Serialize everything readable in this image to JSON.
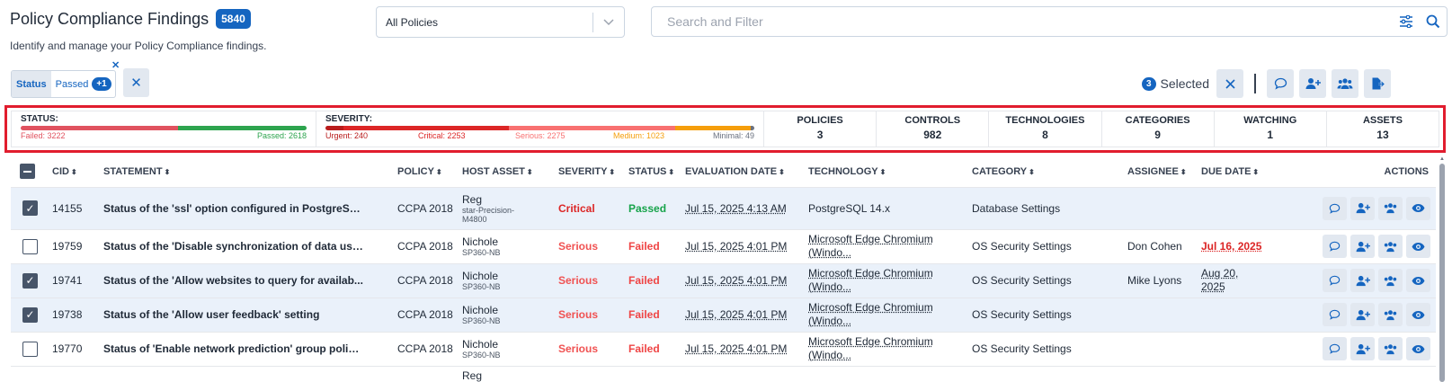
{
  "header": {
    "title": "Policy Compliance Findings",
    "count": "5840",
    "subtitle": "Identify and manage your Policy Compliance findings."
  },
  "policy_select": {
    "value": "All Policies"
  },
  "search": {
    "placeholder": "Search and Filter"
  },
  "filter_chip": {
    "key": "Status",
    "value": "Passed",
    "more": "+1"
  },
  "selection": {
    "count": "3",
    "label": "Selected"
  },
  "summary": {
    "status": {
      "label": "STATUS:",
      "failed_label": "Failed: 3222",
      "passed_label": "Passed: 2618",
      "failed": 3222,
      "passed": 2618,
      "colors": {
        "failed": "#e0525f",
        "passed": "#2da44e"
      }
    },
    "severity": {
      "label": "SEVERITY:",
      "urgent_label": "Urgent: 240",
      "critical_label": "Critical: 2253",
      "serious_label": "Serious: 2275",
      "medium_label": "Medium: 1023",
      "minimal_label": "Minimal: 49",
      "urgent": 240,
      "critical": 2253,
      "serious": 2275,
      "medium": 1023,
      "minimal": 49,
      "colors": {
        "urgent": "#b91c1c",
        "critical": "#dc2626",
        "serious": "#f87171",
        "medium": "#f59e0b",
        "minimal": "#6b7280"
      }
    },
    "metrics": [
      {
        "label": "POLICIES",
        "value": "3"
      },
      {
        "label": "CONTROLS",
        "value": "982"
      },
      {
        "label": "TECHNOLOGIES",
        "value": "8"
      },
      {
        "label": "CATEGORIES",
        "value": "9"
      },
      {
        "label": "WATCHING",
        "value": "1"
      },
      {
        "label": "ASSETS",
        "value": "13"
      }
    ]
  },
  "table": {
    "headers": {
      "cid": "CID",
      "statement": "STATEMENT",
      "policy": "POLICY",
      "host": "HOST ASSET",
      "severity": "SEVERITY",
      "status": "STATUS",
      "eval_date": "EVALUATION DATE",
      "technology": "TECHNOLOGY",
      "category": "CATEGORY",
      "assignee": "ASSIGNEE",
      "due": "DUE DATE",
      "actions": "ACTIONS"
    },
    "rows": [
      {
        "cid": "14155",
        "statement": "Status of the 'ssl' option configured in PostgreSQ...",
        "policy": "CCPA 2018",
        "host": "Reg",
        "host_sub": "star-Precision-M4800",
        "severity": "Critical",
        "status": "Passed",
        "eval_date": "Jul 15, 2025 4:13 AM",
        "technology": "PostgreSQL 14.x",
        "tech2": "",
        "category": "Database Settings",
        "assignee": "",
        "due": ""
      },
      {
        "cid": "19759",
        "statement": "Status of the 'Disable synchronization of data usi...",
        "policy": "CCPA 2018",
        "host": "Nichole",
        "host_sub": "SP360-NB",
        "severity": "Serious",
        "status": "Failed",
        "eval_date": "Jul 15, 2025 4:01 PM",
        "technology": "Microsoft Edge Chromium",
        "tech2": "(Windo...",
        "category": "OS Security Settings",
        "assignee": "Don Cohen",
        "due": "Jul 16, 2025"
      },
      {
        "cid": "19741",
        "statement": "Status of the 'Allow websites to query for availab...",
        "policy": "CCPA 2018",
        "host": "Nichole",
        "host_sub": "SP360-NB",
        "severity": "Serious",
        "status": "Failed",
        "eval_date": "Jul 15, 2025 4:01 PM",
        "technology": "Microsoft Edge Chromium",
        "tech2": "(Windo...",
        "category": "OS Security Settings",
        "assignee": "Mike Lyons",
        "due": "Aug 20,",
        "due2": "2025"
      },
      {
        "cid": "19738",
        "statement": "Status of the 'Allow user feedback' setting",
        "policy": "CCPA 2018",
        "host": "Nichole",
        "host_sub": "SP360-NB",
        "severity": "Serious",
        "status": "Failed",
        "eval_date": "Jul 15, 2025 4:01 PM",
        "technology": "Microsoft Edge Chromium",
        "tech2": "(Windo...",
        "category": "OS Security Settings",
        "assignee": "",
        "due": ""
      },
      {
        "cid": "19770",
        "statement": "Status of 'Enable network prediction' group policy...",
        "policy": "CCPA 2018",
        "host": "Nichole",
        "host_sub": "SP360-NB",
        "severity": "Serious",
        "status": "Failed",
        "eval_date": "Jul 15, 2025 4:01 PM",
        "technology": "Microsoft Edge Chromium",
        "tech2": "(Windo...",
        "category": "OS Security Settings",
        "assignee": "",
        "due": ""
      },
      {
        "host": "Reg"
      }
    ]
  }
}
